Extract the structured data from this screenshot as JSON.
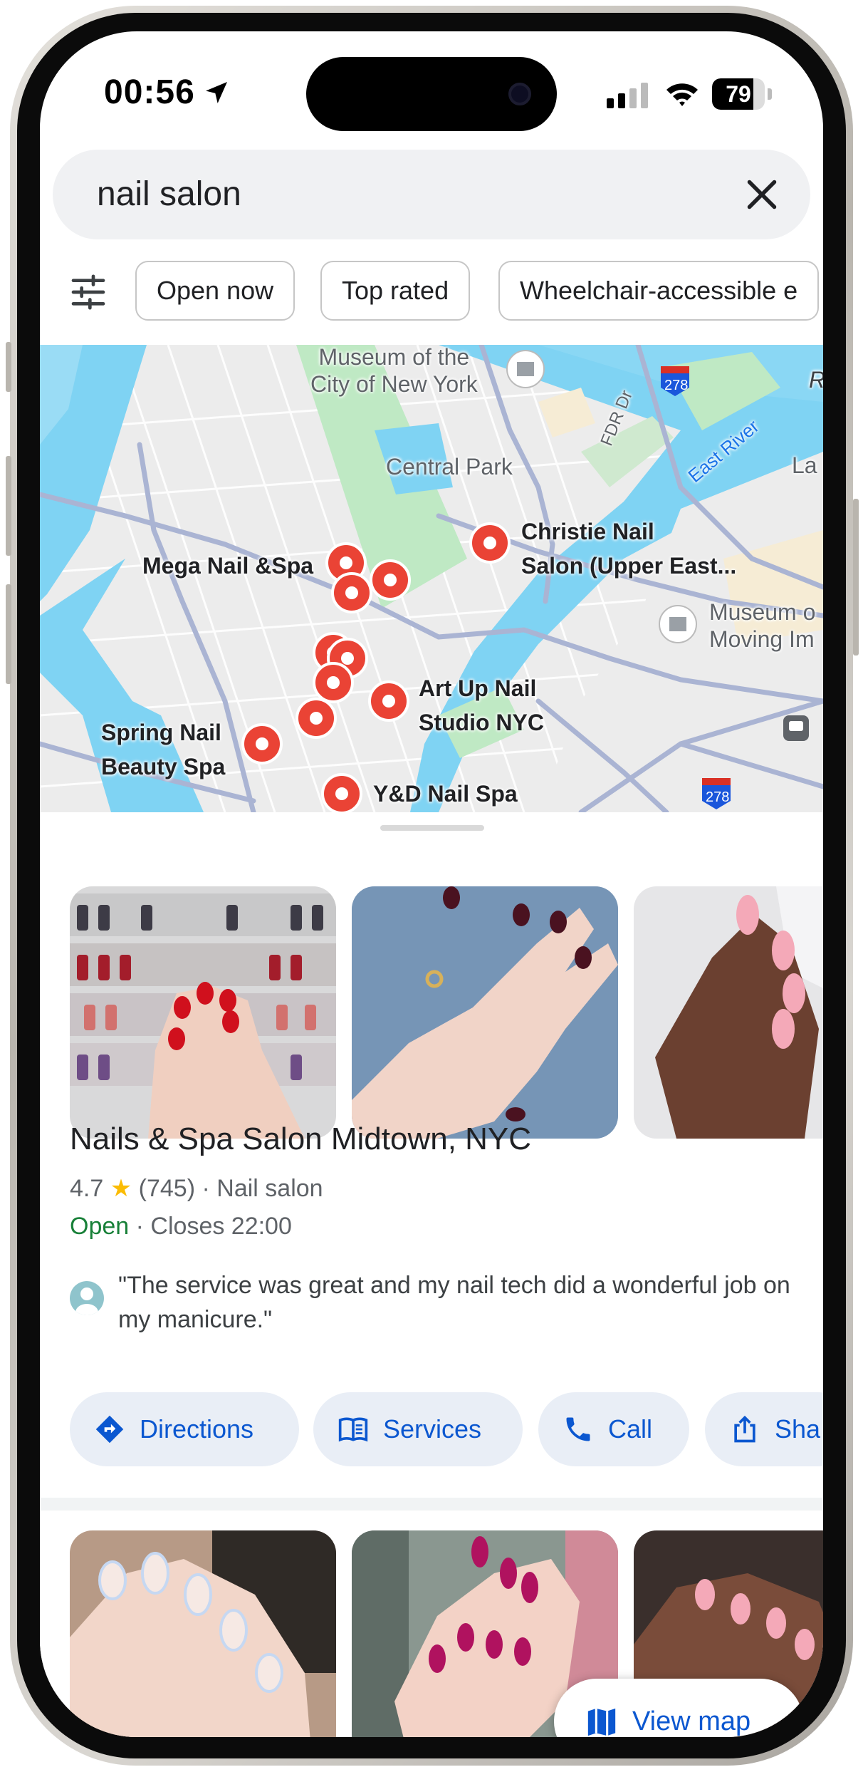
{
  "status_bar": {
    "time": "00:56",
    "battery": "79",
    "battery_level": 0.79
  },
  "search": {
    "query": "nail salon",
    "clear_icon": "close-icon"
  },
  "filters": {
    "icon": "tune-icon",
    "chips": [
      "Open now",
      "Top rated",
      "Wheelchair-accessible e"
    ]
  },
  "map": {
    "labels": {
      "museum_city": "Museum of the\nCity of New York",
      "central_park": "Central Park",
      "fdr": "FDR Dr",
      "east_river": "East River",
      "interstate_top": "278",
      "interstate_bottom": "278",
      "r_edge": "R",
      "la_edge": "La",
      "museum_moving": "Museum o\nMoving Im"
    },
    "places": {
      "christie": "Christie Nail\nSalon (Upper East...",
      "mega": "Mega Nail &Spa",
      "art_up": "Art Up Nail\nStudio NYC",
      "spring": "Spring Nail\nBeauty Spa",
      "yd": "Y&D Nail Spa"
    },
    "colors": {
      "water": "#7fd3f3",
      "park": "#bfe9c4",
      "road": "#aab4d3",
      "pin": "#ea4335"
    }
  },
  "result": {
    "name": "Nails & Spa Salon Midtown, NYC",
    "rating": "4.7",
    "reviews": "(745)",
    "category": "Nail salon",
    "status": "Open",
    "hours": "Closes 22:00",
    "review": "\"The service was great and my nail tech did a wonderful job on my manicure.\"",
    "actions": [
      {
        "label": "Directions",
        "icon": "directions-icon"
      },
      {
        "label": "Services",
        "icon": "menu-book-icon"
      },
      {
        "label": "Call",
        "icon": "phone-icon"
      },
      {
        "label": "Sha",
        "icon": "share-icon"
      }
    ]
  },
  "view_map": {
    "label": "View map",
    "icon": "map-icon"
  }
}
